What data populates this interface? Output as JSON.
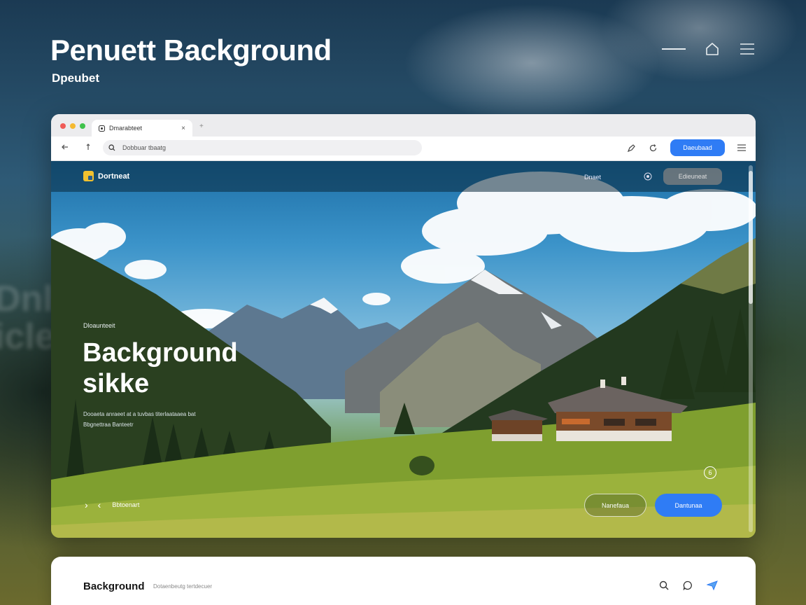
{
  "header": {
    "title": "Penuett Background",
    "subtitle": "Dpeubet"
  },
  "browser": {
    "tab_title": "Dmarabteet",
    "tab_close": "×",
    "new_tab": "+",
    "address_placeholder": "Dobbuar tbaatg",
    "toolbar_button": "Daeubaad"
  },
  "site": {
    "logo_text": "Dortneat",
    "nav_link": "Dnaet",
    "nav_button": "Edieuneat",
    "hero": {
      "kicker": "Dloaunteeit",
      "title_line1": "Background",
      "title_line2": "sikke",
      "description_line1": "Dooaeta anraeet at a tuvbas titerlaataaea bat",
      "description_line2": "Bbgnettraa Banteetr"
    },
    "carousel": {
      "next": "›",
      "prev": "‹",
      "label": "Bbtoenart"
    },
    "badge": "6",
    "secondary_button": "Nanefaua",
    "primary_button": "Dantunaa"
  },
  "bottom": {
    "title": "Background",
    "subtitle": "Dotaenbeutg tertdecuer"
  },
  "backdrop_ghost_text": "Dnly\nicle",
  "colors": {
    "accent": "#2f7cf5",
    "traffic_red": "#f05b57",
    "traffic_yellow": "#f5b930",
    "traffic_green": "#3fc24b",
    "logo_yellow": "#f2c12e"
  },
  "icons": {
    "top": [
      "minimize-line",
      "home-icon",
      "menu-icon"
    ],
    "toolbar": [
      "back-icon",
      "refresh-icon",
      "search-icon",
      "share-icon",
      "sync-icon",
      "menu-icon"
    ],
    "bottom": [
      "search-icon",
      "chat-icon",
      "send-icon"
    ]
  }
}
